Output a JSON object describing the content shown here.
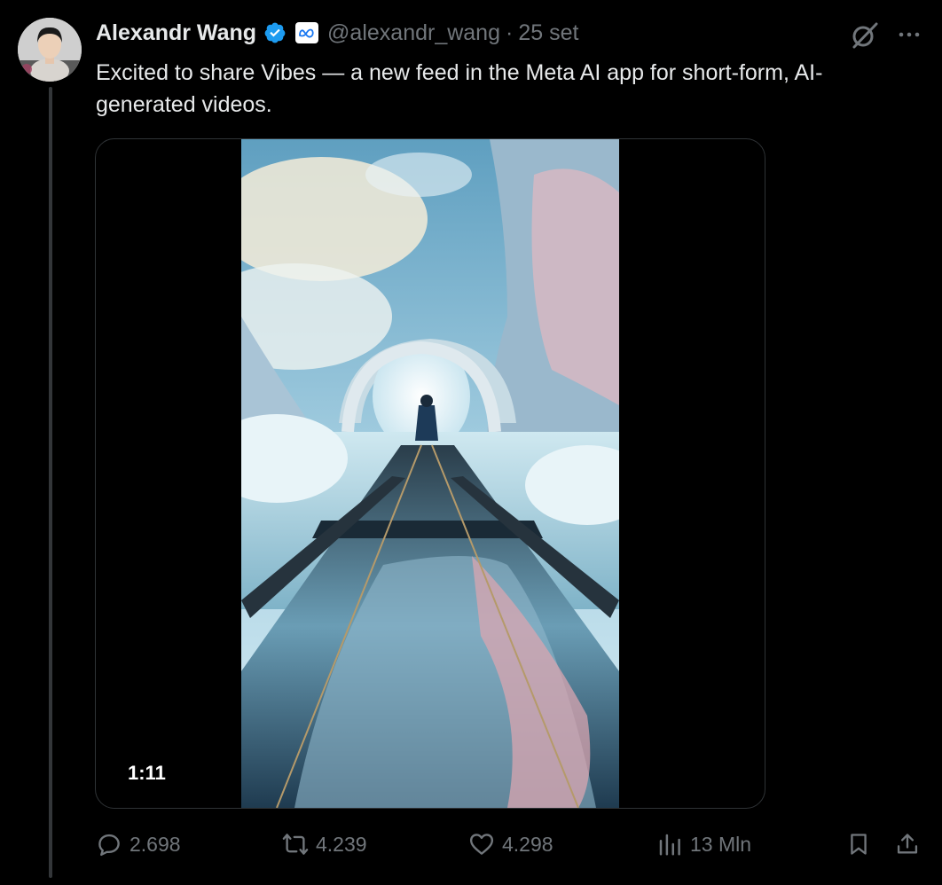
{
  "tweet": {
    "author_name": "Alexandr Wang",
    "handle": "@alexandr_wang",
    "separator": "·",
    "time": "25 set",
    "text": "Excited to share Vibes — a new feed in the Meta AI app for short-form, AI-generated videos."
  },
  "media": {
    "duration": "1:11"
  },
  "stats": {
    "replies": "2.698",
    "reposts": "4.239",
    "likes": "4.298",
    "views": "13 Mln"
  },
  "icons": {
    "verified": "verified-badge-icon",
    "affiliation": "meta-logo-icon",
    "grok": "grok-icon",
    "more": "more-icon",
    "reply": "reply-icon",
    "repost": "repost-icon",
    "like": "heart-icon",
    "views": "views-icon",
    "bookmark": "bookmark-icon",
    "share": "share-icon"
  },
  "colors": {
    "background": "#000000",
    "text": "#e7e9ea",
    "secondary": "#71767b",
    "verified": "#1d9bf0",
    "border": "#2f3336"
  }
}
